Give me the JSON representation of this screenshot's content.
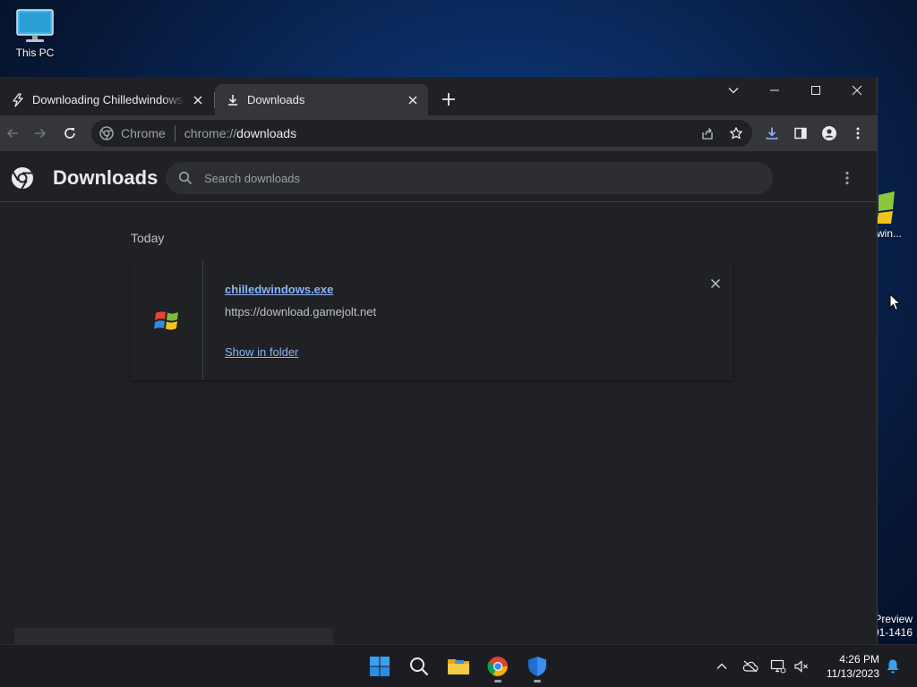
{
  "desktop": {
    "this_pc_label": "This PC",
    "partial_icon_label": "win...",
    "watermark_line1": "Preview",
    "watermark_line2": "01-1416"
  },
  "browser": {
    "tabs": [
      {
        "title": "Downloading Chilledwindows.exe",
        "icon": "lightning-icon",
        "active": false
      },
      {
        "title": "Downloads",
        "icon": "download-icon",
        "active": true
      }
    ],
    "omnibox": {
      "chip_label": "Chrome",
      "url_scheme": "chrome://",
      "url_host": "downloads"
    }
  },
  "downloads_page": {
    "title": "Downloads",
    "search_placeholder": "Search downloads",
    "section_label": "Today",
    "items": [
      {
        "file_name": "chilledwindows.exe",
        "source_url": "https://download.gamejolt.net",
        "action_label": "Show in folder",
        "icon": "windows-flag-icon"
      }
    ]
  },
  "taskbar": {
    "apps": [
      "start-icon",
      "search-icon",
      "file-explorer-icon",
      "chrome-icon",
      "defender-icon"
    ],
    "time": "4:26 PM",
    "date": "11/13/2023"
  },
  "colors": {
    "page_bg": "#202124",
    "toolbar_bg": "#35363a",
    "link": "#8ab4f8",
    "text": "#e8eaed"
  }
}
